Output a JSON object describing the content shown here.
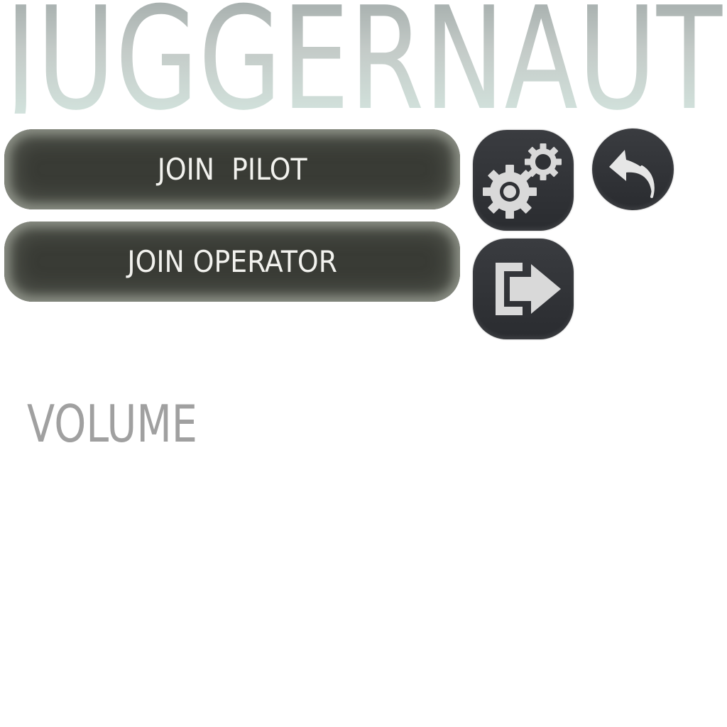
{
  "title": {
    "text": "JUGGERNAUT"
  },
  "menu": {
    "join_pilot_label": "JOIN  PILOT",
    "join_operator_label": "JOIN OPERATOR"
  },
  "icons": {
    "settings": "gears-icon",
    "exit": "exit-arrow-icon",
    "back": "back-arrow-icon"
  },
  "settings": {
    "volume_label": "VOLUME"
  },
  "colors": {
    "button_fill": "#393b35",
    "button_glow": "#8a8e84",
    "icon_button_fill": "#2d2f33",
    "icon_glyph": "#d9d9d9",
    "title_gradient_start": "#bfc4c6",
    "title_gradient_end": "#d6ece6",
    "volume_text": "#a0a0a0"
  }
}
